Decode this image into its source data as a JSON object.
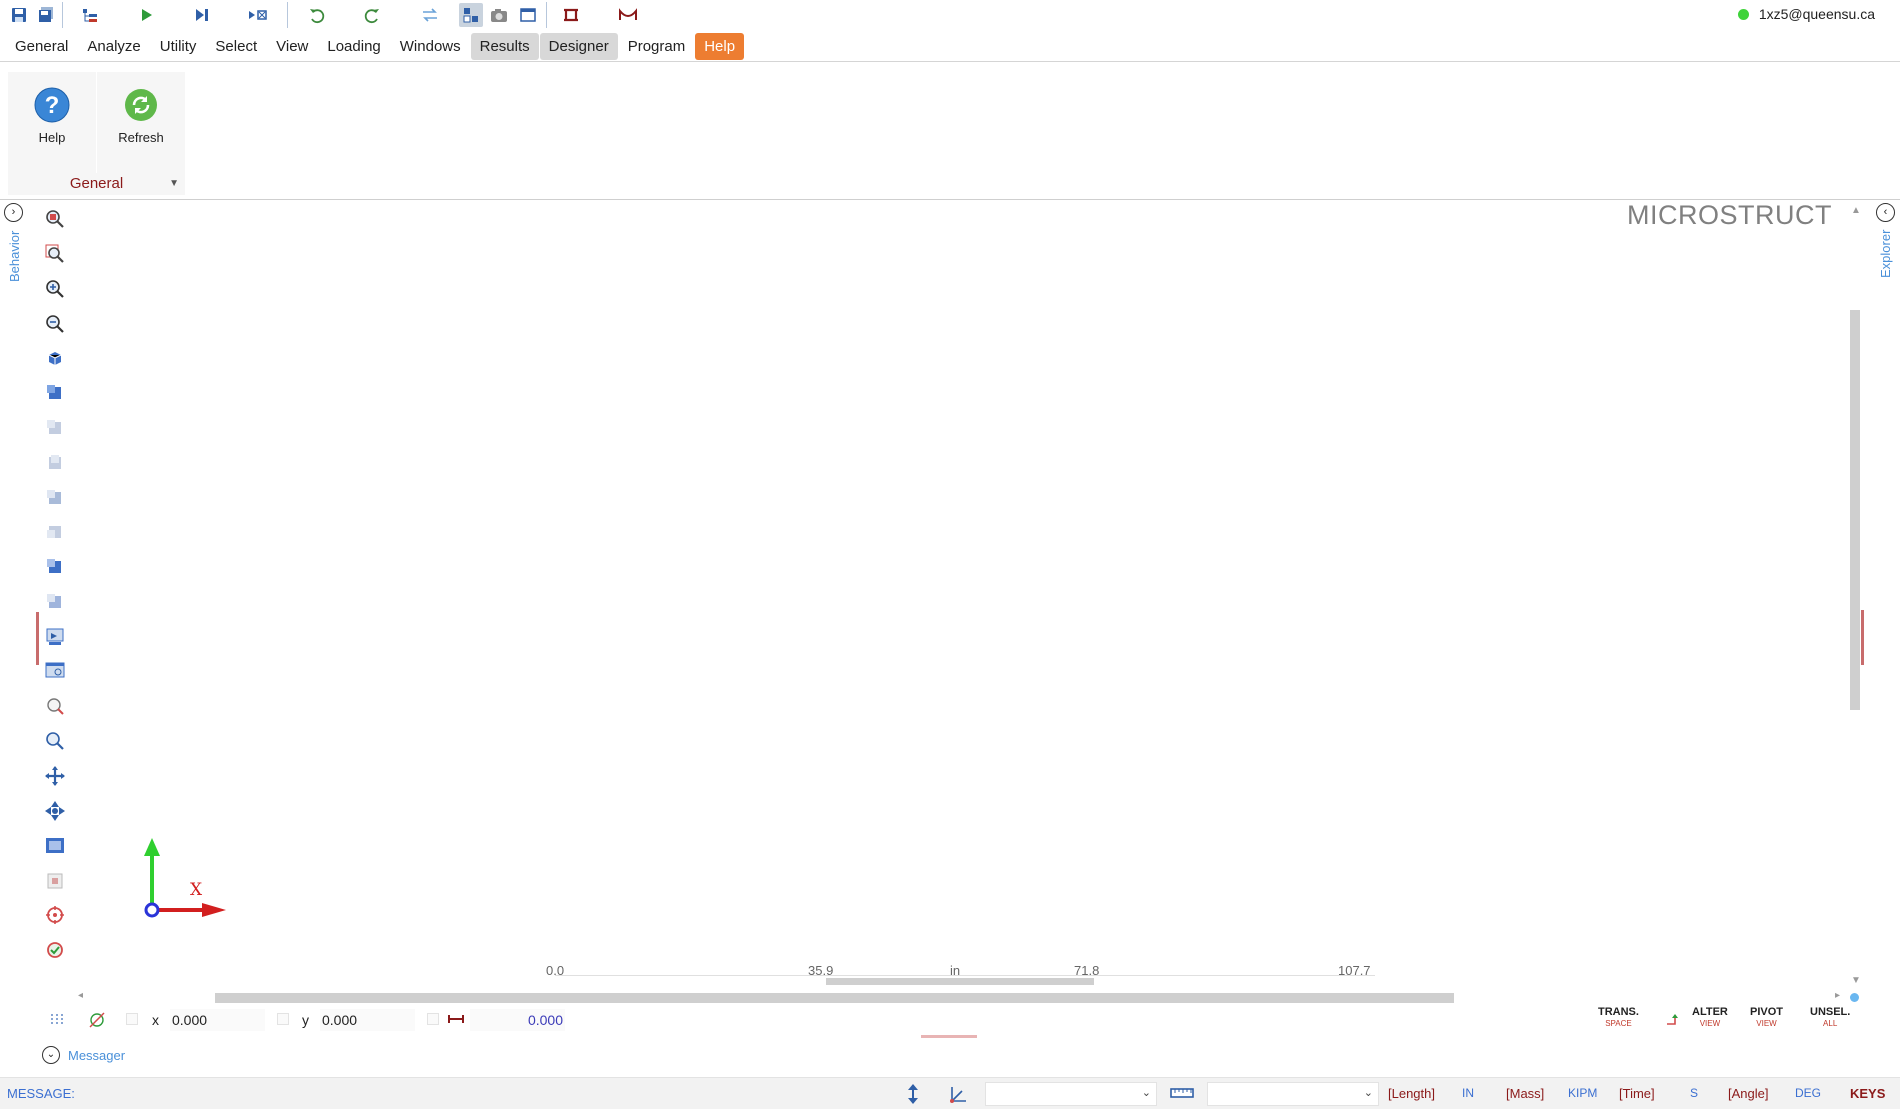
{
  "account": {
    "email": "1xz5@queensu.ca",
    "status_color": "#3fd33a"
  },
  "menu_tabs": [
    "General",
    "Analyze",
    "Utility",
    "Select",
    "View",
    "Loading",
    "Windows",
    "Results",
    "Designer",
    "Program",
    "Help"
  ],
  "ribbon": {
    "buttons": [
      {
        "label": "Help",
        "icon": "help-icon"
      },
      {
        "label": "Refresh",
        "icon": "refresh-icon"
      }
    ],
    "group_label": "General"
  },
  "left_panel": {
    "label": "Behavior"
  },
  "right_panel": {
    "label": "Explorer"
  },
  "viewport": {
    "brand": "MICROSTRUCT",
    "axis_label": "X",
    "ruler": {
      "ticks": [
        "0.0",
        "35.9",
        "71.8",
        "107.7"
      ],
      "unit": "in"
    }
  },
  "coords": {
    "x_label": "x",
    "x_value": "0.000",
    "y_label": "y",
    "y_value": "0.000",
    "dist_value": "0.000"
  },
  "view_buttons": [
    {
      "label": "TRANS.",
      "sub": "SPACE"
    },
    {
      "label": "ALTER",
      "sub": "VIEW"
    },
    {
      "label": "PIVOT",
      "sub": "VIEW"
    },
    {
      "label": "UNSEL.",
      "sub": "ALL"
    }
  ],
  "messager": {
    "label": "Messager"
  },
  "status": {
    "message_label": "MESSAGE:",
    "units": [
      {
        "label": "[Length]",
        "value": "IN"
      },
      {
        "label": "[Mass]",
        "value": "KIPM"
      },
      {
        "label": "[Time]",
        "value": "S"
      },
      {
        "label": "[Angle]",
        "value": "DEG"
      }
    ],
    "keys_label": "KEYS"
  },
  "colors": {
    "accent": "#ed7d31",
    "dark_red": "#8b1a1a",
    "link_blue": "#4a90d9"
  }
}
